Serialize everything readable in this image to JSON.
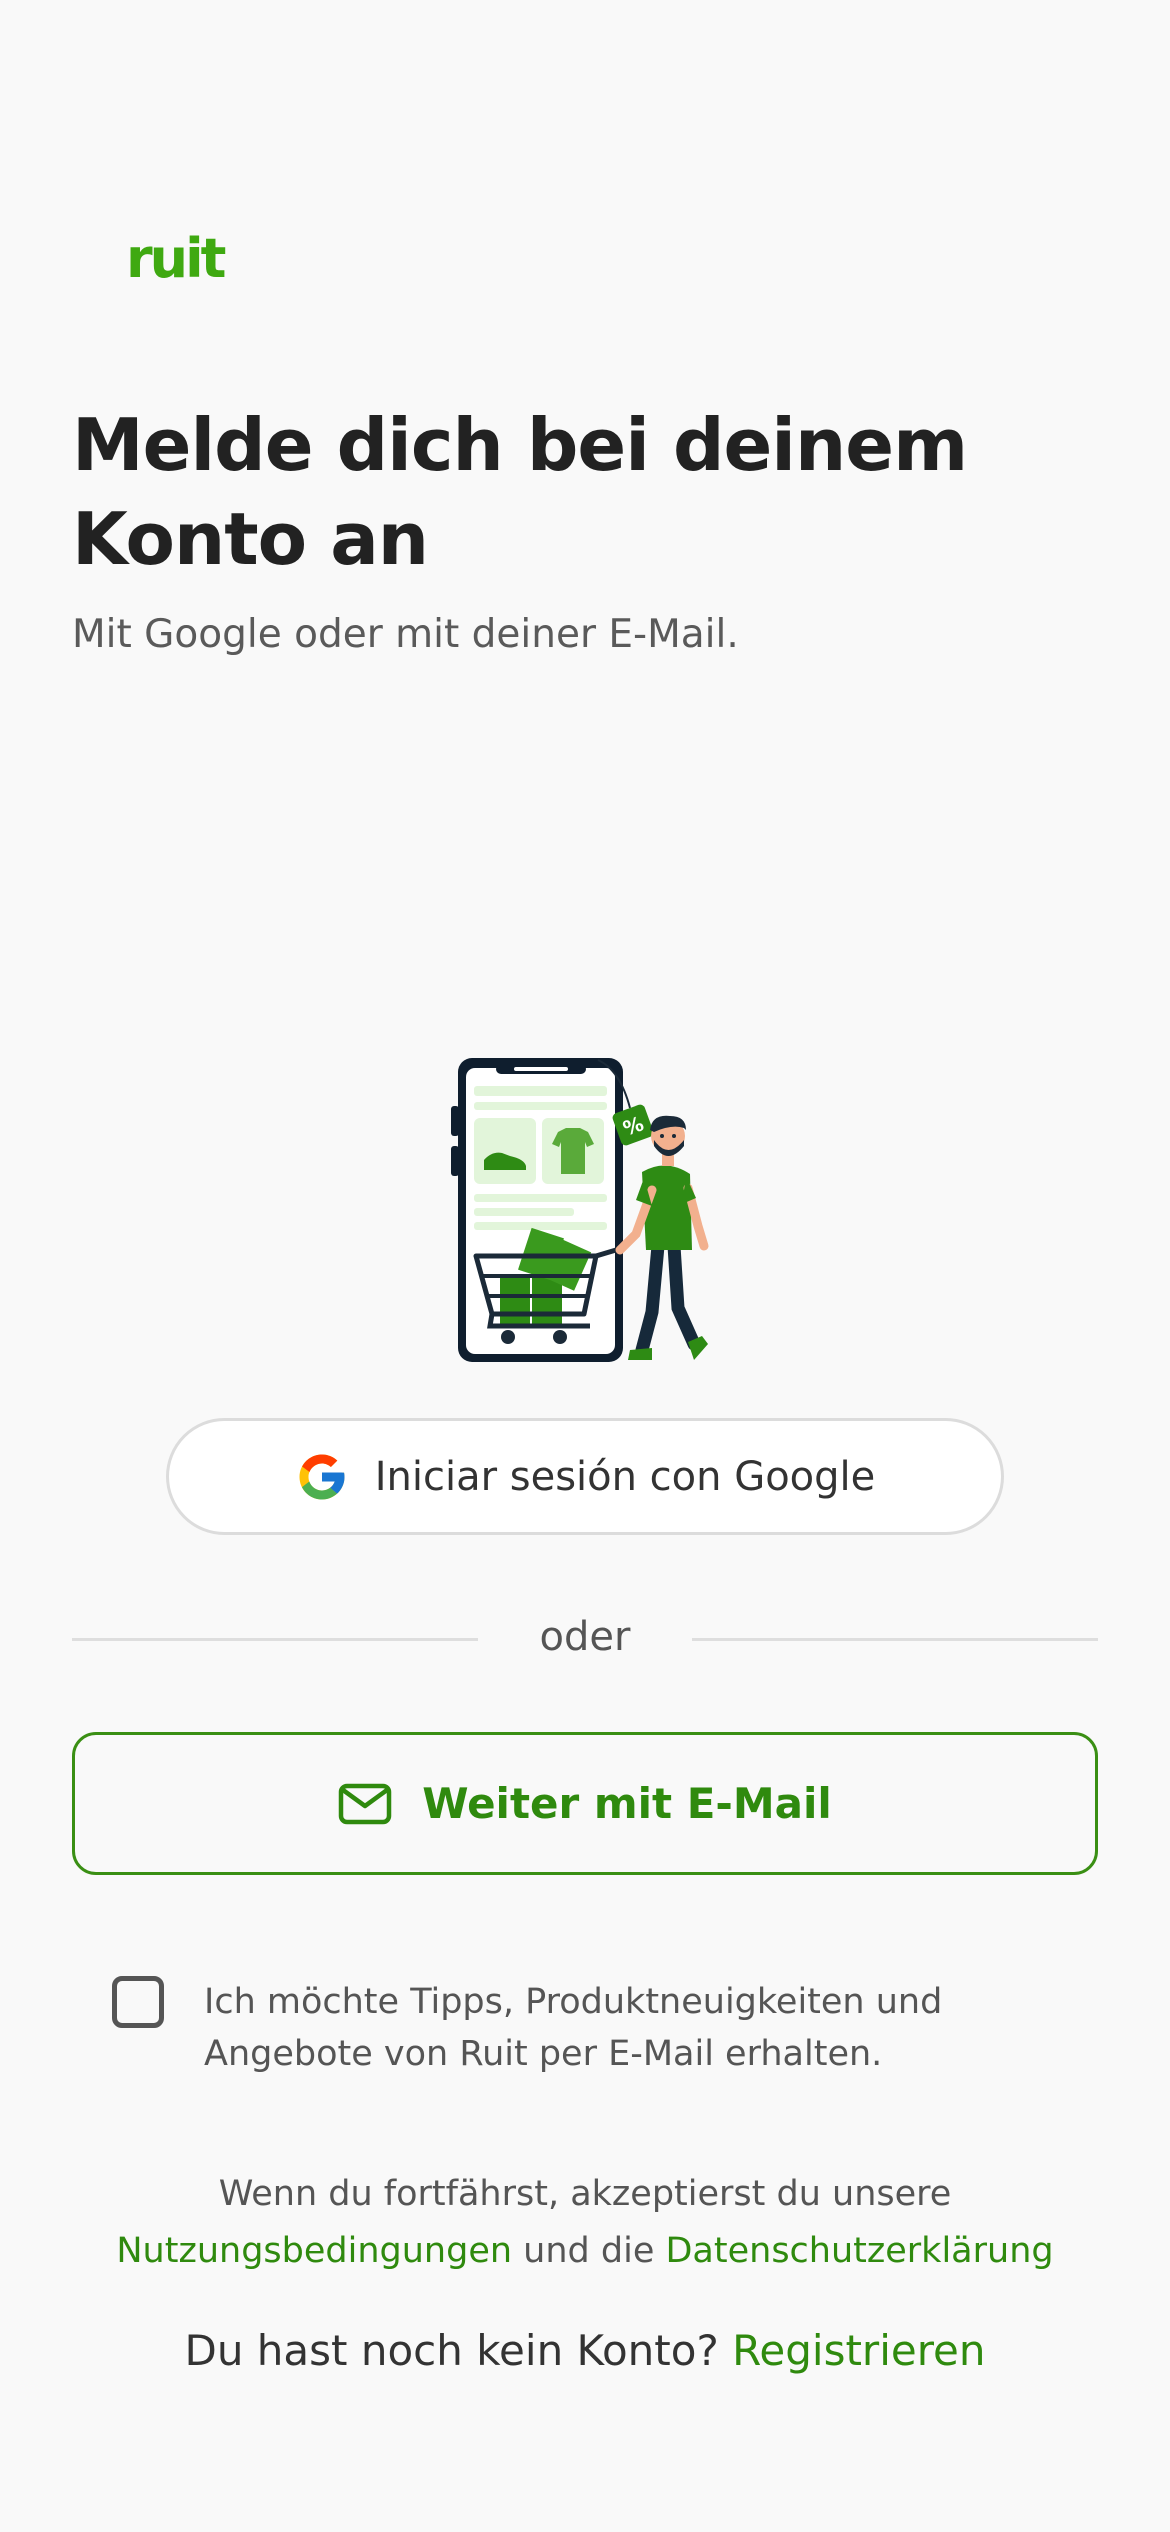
{
  "brand": {
    "logo_text": "ruit",
    "accent_color": "#3fa911",
    "link_color": "#2f8a0e"
  },
  "header": {
    "title": "Melde dich bei deinem Konto an",
    "subtitle": "Mit Google oder mit deiner E-Mail."
  },
  "illustration": {
    "icon": "shopping-illustration",
    "tag_text": "%"
  },
  "google_button": {
    "label": "Iniciar sesión con Google",
    "icon": "google-icon"
  },
  "divider": {
    "text": "oder"
  },
  "email_button": {
    "label": "Weiter mit E-Mail",
    "icon": "mail-icon"
  },
  "newsletter": {
    "checked": false,
    "label": "Ich möchte Tipps, Produktneuigkeiten und Angebote von Ruit per E-Mail erhalten."
  },
  "legal": {
    "text_before": "Wenn du fortfährst, akzeptierst du unsere",
    "terms_link": "Nutzungsbedingungen",
    "connector": " und die ",
    "privacy_link": "Datenschutzerklärung"
  },
  "signup": {
    "prompt": "Du hast noch kein Konto? ",
    "link": "Registrieren"
  }
}
